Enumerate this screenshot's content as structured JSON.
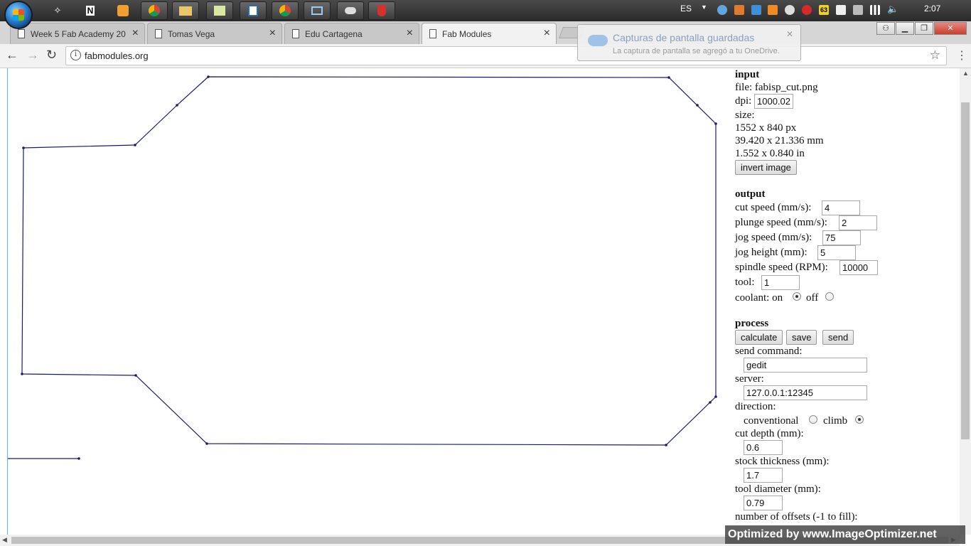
{
  "taskbar": {
    "language": "ES",
    "clock": "2:07",
    "tray_badge": "63",
    "apps": [
      "media-icon",
      "notepad-icon",
      "player-icon",
      "chrome-icon",
      "explorer-icon",
      "files-icon",
      "app-icon",
      "chrome-icon",
      "window-icon",
      "gimp-icon",
      "app-red-icon"
    ]
  },
  "tabs": [
    {
      "title": "Week 5 Fab Academy 20",
      "active": false
    },
    {
      "title": "Tomas Vega",
      "active": false
    },
    {
      "title": "Edu Cartagena",
      "active": false
    },
    {
      "title": "Fab Modules",
      "active": true
    }
  ],
  "toolbar": {
    "url": "fabmodules.org"
  },
  "toast": {
    "title": "Capturas de pantalla guardadas",
    "message": "La captura de pantalla se agregó a tu OneDrive."
  },
  "panel": {
    "input": {
      "heading": "input",
      "file_label": "file: fabisp_cut.png",
      "dpi_label": "dpi:",
      "dpi_value": "1000.02",
      "size_label": "size:",
      "size_px": "1552 x 840 px",
      "size_mm": "39.420 x 21.336 mm",
      "size_in": "1.552 x 0.840 in",
      "invert_button": "invert image"
    },
    "output": {
      "heading": "output",
      "cut_speed_label": "cut speed (mm/s):",
      "cut_speed": "4",
      "plunge_speed_label": "plunge speed (mm/s):",
      "plunge_speed": "2",
      "jog_speed_label": "jog speed (mm/s):",
      "jog_speed": "75",
      "jog_height_label": "jog height (mm):",
      "jog_height": "5",
      "spindle_label": "spindle speed (RPM):",
      "spindle_speed": "10000",
      "tool_label": "tool:",
      "tool": "1",
      "coolant_label": "coolant: on",
      "coolant_off_label": "off",
      "coolant": "on"
    },
    "process": {
      "heading": "process",
      "calculate_button": "calculate",
      "save_button": "save",
      "send_button": "send",
      "send_command_label": "send command:",
      "send_command": "gedit",
      "server_label": "server:",
      "server": "127.0.0.1:12345",
      "direction_label": "direction:",
      "conventional_label": "conventional",
      "climb_label": "climb",
      "direction": "climb",
      "cut_depth_label": "cut depth (mm):",
      "cut_depth": "0.6",
      "stock_thickness_label": "stock thickness (mm):",
      "stock_thickness": "1.7",
      "tool_diameter_label": "tool diameter (mm):",
      "tool_diameter": "0.79",
      "offsets_label": "number of offsets (-1 to fill):"
    }
  },
  "colors": {
    "toolpath": "#1a1a6e",
    "accent_line": "#4fc1e9"
  },
  "watermark": "Optimized by www.ImageOptimizer.net"
}
